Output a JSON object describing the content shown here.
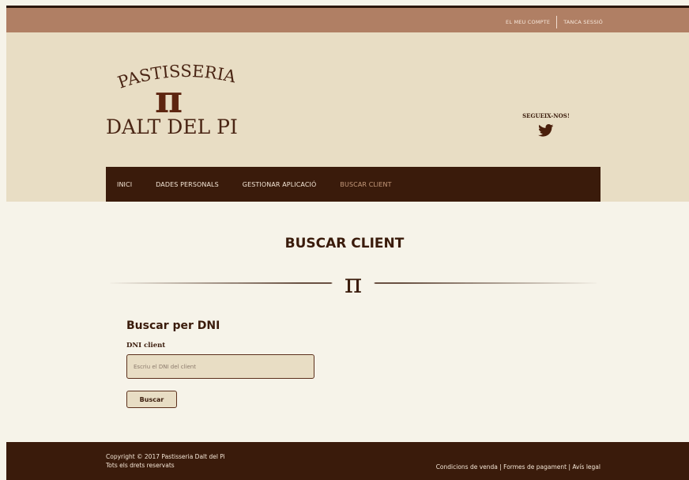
{
  "topbar": {
    "account_link": "EL MEU COMPTE",
    "logout_link": "TANCA SESSIÓ"
  },
  "logo": {
    "line1": "PASTISSERIA",
    "symbol": "π",
    "line2": "DALT DEL PI"
  },
  "social": {
    "label": "SEGUEIX-NOS!",
    "icon": "twitter-icon"
  },
  "nav": {
    "items": [
      {
        "label": "INICI"
      },
      {
        "label": "DADES PERSONALS"
      },
      {
        "label": "GESTIONAR APLICACIÓ"
      },
      {
        "label": "BUSCAR CLIENT",
        "active": true
      }
    ]
  },
  "page": {
    "title": "BUSCAR CLIENT",
    "divider_symbol": "π"
  },
  "form": {
    "heading": "Buscar per DNI",
    "field_label": "DNI client",
    "field_placeholder": "Escriu el DNI del client",
    "field_value": "",
    "submit_label": "Buscar"
  },
  "footer": {
    "copyright_line1": "Copyright © 2017 Pastisseria Dalt del Pi",
    "copyright_line2": "Tots els drets reservats",
    "legal_links": "Condicions de venda | Formes de pagament | Avís legal"
  },
  "colors": {
    "topbar": "#b07f64",
    "header": "#e8ddc4",
    "nav": "#3a1b0b",
    "nav_active": "#c59a7c",
    "body": "#f6f3e9",
    "text_dark": "#3a1b0b"
  }
}
